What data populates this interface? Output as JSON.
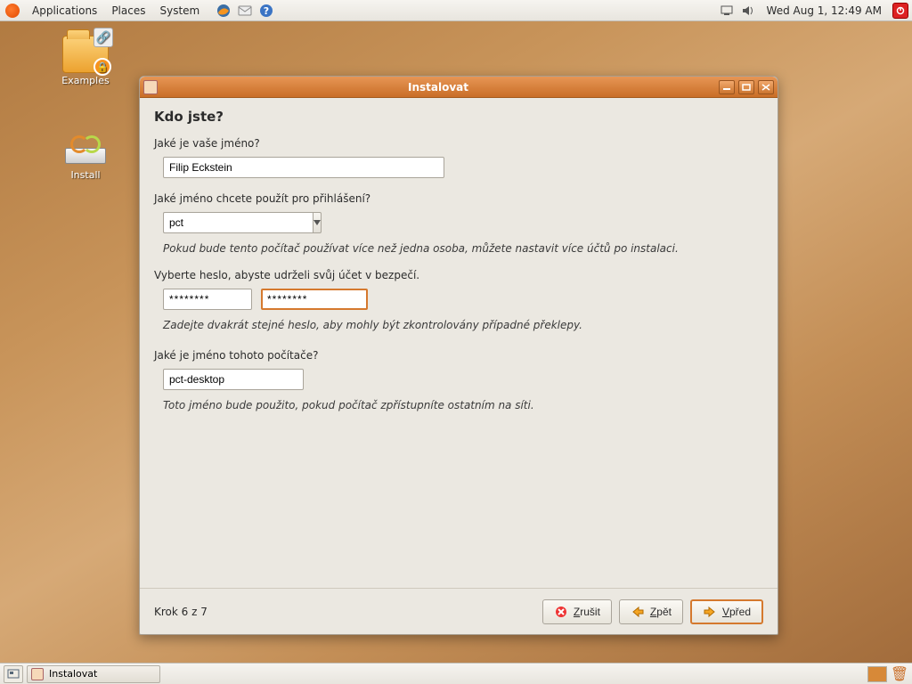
{
  "panel": {
    "menus": [
      "Applications",
      "Places",
      "System"
    ],
    "clock": "Wed Aug  1, 12:49 AM"
  },
  "desktop": {
    "examples": "Examples",
    "install": "Install"
  },
  "window": {
    "title": "Instalovat",
    "heading": "Kdo jste?",
    "name_label": "Jaké je vaše jméno?",
    "name_value": "Filip Eckstein",
    "login_label": "Jaké jméno chcete použít pro přihlášení?",
    "login_value": "pct",
    "login_hint": "Pokud bude tento počítač používat více než jedna osoba, můžete nastavit více účtů po instalaci.",
    "password_label": "Vyberte heslo, abyste udrželi svůj účet v bezpečí.",
    "password_value1": "********",
    "password_value2": "********",
    "password_hint": "Zadejte dvakrát stejné heslo, aby mohly být zkontrolovány případné překlepy.",
    "hostname_label": "Jaké je jméno tohoto počítače?",
    "hostname_value": "pct-desktop",
    "hostname_hint": "Toto jméno bude použito, pokud počítač zpřístupníte ostatním na síti.",
    "step": "Krok 6 z 7",
    "btn_cancel_pre": "",
    "btn_cancel_u": "Z",
    "btn_cancel_post": "rušit",
    "btn_back_pre": "",
    "btn_back_u": "Z",
    "btn_back_post": "pět",
    "btn_fwd_pre": "",
    "btn_fwd_u": "V",
    "btn_fwd_post": "před"
  },
  "taskbar": {
    "task1": "Instalovat"
  }
}
